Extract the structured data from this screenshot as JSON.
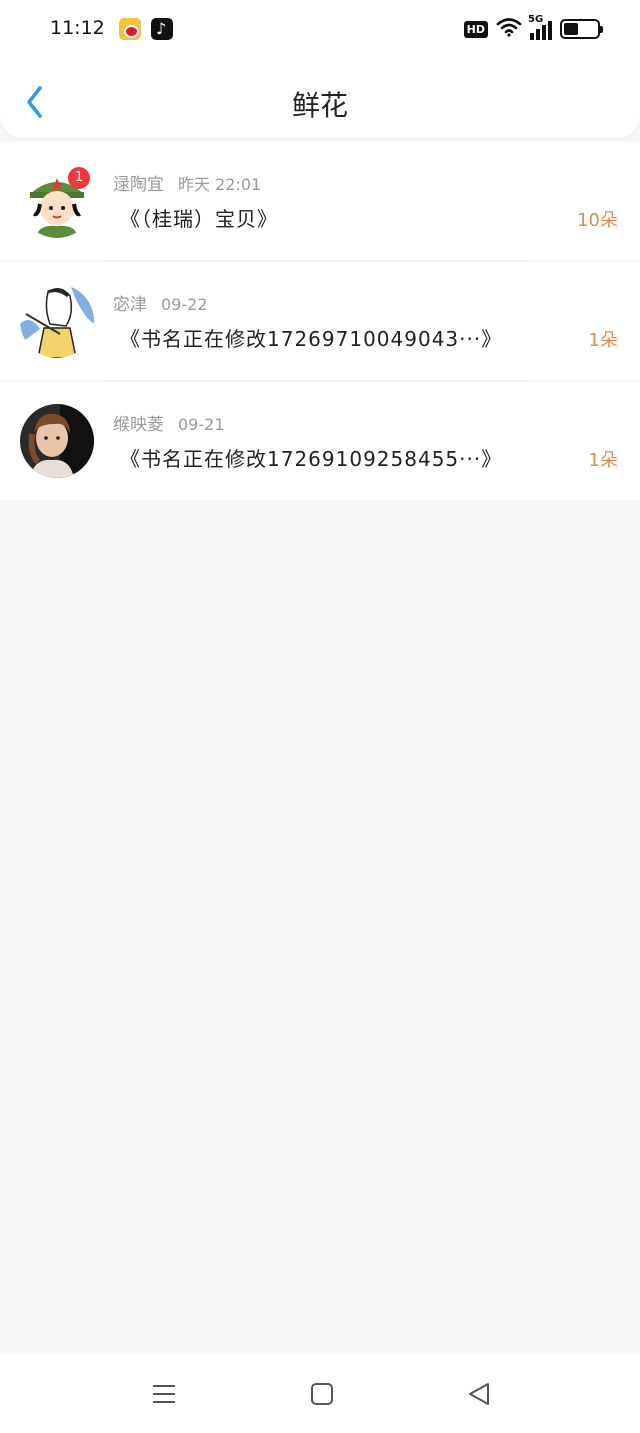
{
  "status_bar": {
    "time": "11:12",
    "network": "5G",
    "hd_label": "HD",
    "battery_level": 0.45,
    "app_icons": [
      "weibo-icon",
      "tiktok-icon"
    ]
  },
  "header": {
    "title": "鲜花",
    "back_icon": "chevron-left-icon",
    "accent_color": "#2c9be6"
  },
  "list": {
    "items": [
      {
        "name": "逯陶宜",
        "date": "昨天 22:01",
        "message": "《（桂瑞）宝贝》",
        "count": "10朵",
        "badge": "1"
      },
      {
        "name": "宓津",
        "date": "09-22",
        "message": "《书名正在修改17269710049043···》",
        "count": "1朵"
      },
      {
        "name": "缑映菱",
        "date": "09-21",
        "message": "《书名正在修改17269109258455···》",
        "count": "1朵"
      }
    ]
  },
  "system_nav": {
    "icons": [
      "menu-icon",
      "home-icon",
      "back-triangle-icon"
    ]
  },
  "colors": {
    "count": "#e08a4e",
    "badge": "#f2373c",
    "meta": "#9a9a9a"
  }
}
